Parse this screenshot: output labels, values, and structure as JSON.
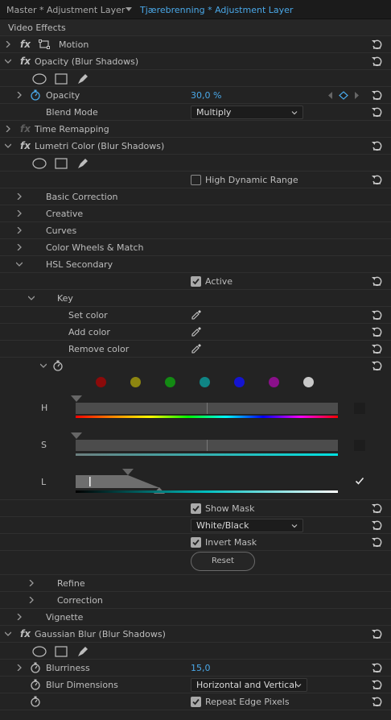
{
  "tabs": {
    "master": "Master * Adjustment Layer",
    "active": "Tjærebrenning * Adjustment Layer"
  },
  "section_title": "Video Effects",
  "motion": {
    "label": "Motion"
  },
  "opacity": {
    "label": "Opacity (Blur Shadows)",
    "param_label": "Opacity",
    "value": "30,0 %",
    "blend_label": "Blend Mode",
    "blend_value": "Multiply"
  },
  "time_remapping": {
    "label": "Time Remapping"
  },
  "lumetri": {
    "label": "Lumetri Color (Blur Shadows)",
    "hdr_label": "High Dynamic Range",
    "sections": [
      "Basic Correction",
      "Creative",
      "Curves",
      "Color Wheels & Match",
      "HSL Secondary"
    ],
    "active_label": "Active",
    "key_label": "Key",
    "set_color": "Set color",
    "add_color": "Add color",
    "remove_color": "Remove color",
    "color_swatches": [
      "#8b0a0a",
      "#8c8510",
      "#138a13",
      "#0f8585",
      "#1414d0",
      "#8a108a",
      "#c8c8c8"
    ],
    "h_label": "H",
    "s_label": "S",
    "l_label": "L",
    "show_mask": "Show Mask",
    "mask_mode": "White/Black",
    "invert_mask": "Invert Mask",
    "reset_label": "Reset",
    "refine": "Refine",
    "correction": "Correction",
    "vignette": "Vignette"
  },
  "gaussian": {
    "label": "Gaussian Blur (Blur Shadows)",
    "blurriness_label": "Blurriness",
    "blurriness_value": "15,0",
    "dimensions_label": "Blur Dimensions",
    "dimensions_value": "Horizontal and Vertical",
    "repeat_edge": "Repeat Edge Pixels"
  },
  "colors": {
    "accent": "#4aa8e8",
    "background": "#232323"
  }
}
